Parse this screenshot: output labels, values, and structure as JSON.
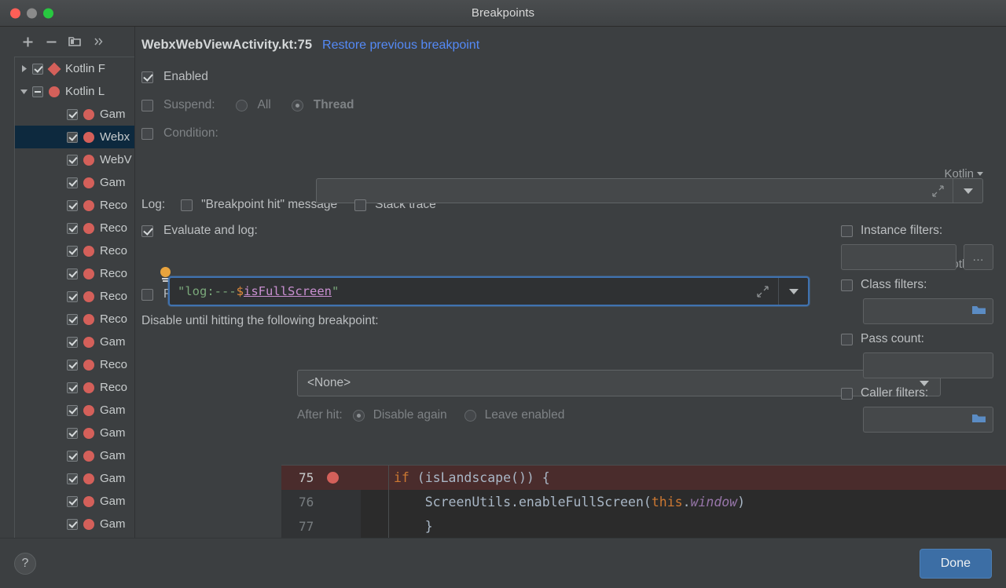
{
  "window": {
    "title": "Breakpoints",
    "traffic_lights": [
      "close",
      "minimize",
      "zoom"
    ]
  },
  "sidebar": {
    "toolbar": [
      {
        "name": "add-breakpoint-button",
        "icon": "plus-icon",
        "label": "+"
      },
      {
        "name": "remove-breakpoint-button",
        "icon": "minus-icon",
        "label": "−"
      },
      {
        "name": "group-breakpoints-button",
        "icon": "folder-icon",
        "label": ""
      },
      {
        "name": "more-options-button",
        "icon": "chevron-double-right-icon",
        "label": "»"
      }
    ],
    "items": [
      {
        "label": "Kotlin F",
        "indent": 0,
        "twisty": "collapsed",
        "checkbox": "checked",
        "marker": "diamond",
        "selected": false
      },
      {
        "label": "Kotlin L",
        "indent": 0,
        "twisty": "expanded",
        "checkbox": "mixed",
        "marker": "dot",
        "selected": false
      },
      {
        "label": "Gam",
        "indent": 1,
        "twisty": "",
        "checkbox": "checked",
        "marker": "dot",
        "selected": false
      },
      {
        "label": "Webx",
        "indent": 1,
        "twisty": "",
        "checkbox": "checked",
        "marker": "dot",
        "selected": true
      },
      {
        "label": "WebV",
        "indent": 1,
        "twisty": "",
        "checkbox": "checked",
        "marker": "dot",
        "selected": false
      },
      {
        "label": "Gam",
        "indent": 1,
        "twisty": "",
        "checkbox": "checked",
        "marker": "dot",
        "selected": false
      },
      {
        "label": "Reco",
        "indent": 1,
        "twisty": "",
        "checkbox": "checked",
        "marker": "dot",
        "selected": false
      },
      {
        "label": "Reco",
        "indent": 1,
        "twisty": "",
        "checkbox": "checked",
        "marker": "dot",
        "selected": false
      },
      {
        "label": "Reco",
        "indent": 1,
        "twisty": "",
        "checkbox": "checked",
        "marker": "dot",
        "selected": false
      },
      {
        "label": "Reco",
        "indent": 1,
        "twisty": "",
        "checkbox": "checked",
        "marker": "dot",
        "selected": false
      },
      {
        "label": "Reco",
        "indent": 1,
        "twisty": "",
        "checkbox": "checked",
        "marker": "dot",
        "selected": false
      },
      {
        "label": "Reco",
        "indent": 1,
        "twisty": "",
        "checkbox": "checked",
        "marker": "dot",
        "selected": false
      },
      {
        "label": "Gam",
        "indent": 1,
        "twisty": "",
        "checkbox": "checked",
        "marker": "dot",
        "selected": false
      },
      {
        "label": "Reco",
        "indent": 1,
        "twisty": "",
        "checkbox": "checked",
        "marker": "dot",
        "selected": false
      },
      {
        "label": "Reco",
        "indent": 1,
        "twisty": "",
        "checkbox": "checked",
        "marker": "dot",
        "selected": false
      },
      {
        "label": "Gam",
        "indent": 1,
        "twisty": "",
        "checkbox": "checked",
        "marker": "dot",
        "selected": false
      },
      {
        "label": "Gam",
        "indent": 1,
        "twisty": "",
        "checkbox": "checked",
        "marker": "dot",
        "selected": false
      },
      {
        "label": "Gam",
        "indent": 1,
        "twisty": "",
        "checkbox": "checked",
        "marker": "dot",
        "selected": false
      },
      {
        "label": "Gam",
        "indent": 1,
        "twisty": "",
        "checkbox": "checked",
        "marker": "dot",
        "selected": false
      },
      {
        "label": "Gam",
        "indent": 1,
        "twisty": "",
        "checkbox": "checked",
        "marker": "dot",
        "selected": false
      },
      {
        "label": "Gam",
        "indent": 1,
        "twisty": "",
        "checkbox": "checked",
        "marker": "dot",
        "selected": false
      }
    ]
  },
  "details": {
    "title": "WebxWebViewActivity.kt:75",
    "restore_link": "Restore previous breakpoint",
    "enabled": {
      "label": "Enabled",
      "checked": true
    },
    "suspend": {
      "label": "Suspend:",
      "checked": false,
      "options": [
        "All",
        "Thread"
      ],
      "selected": "Thread"
    },
    "condition": {
      "label": "Condition:",
      "checked": false,
      "value": "",
      "language": "Kotlin"
    },
    "log": {
      "label": "Log:",
      "breakpoint_hit_message": {
        "label": "\"Breakpoint hit\" message",
        "checked": false
      },
      "stack_trace": {
        "label": "Stack trace",
        "checked": false
      }
    },
    "evaluate_and_log": {
      "label": "Evaluate and log:",
      "checked": true,
      "language": "Kotlin",
      "code_tokens": [
        {
          "text": "\"log:---",
          "kind": "string"
        },
        {
          "text": "$",
          "kind": "dollar"
        },
        {
          "text": "isFullScreen",
          "kind": "variable"
        },
        {
          "text": "\"",
          "kind": "string"
        }
      ],
      "code_plain": "\"log:---$isFullScreen\""
    },
    "remove_once_hit": {
      "label": "Remove once hit",
      "checked": false
    },
    "disable_until": {
      "label": "Disable until hitting the following breakpoint:",
      "value": "<None>"
    },
    "after_hit": {
      "label": "After hit:",
      "options": [
        "Disable again",
        "Leave enabled"
      ],
      "selected": "Disable again",
      "disabled": true
    }
  },
  "filters": {
    "instance": {
      "label": "Instance filters:",
      "checked": false,
      "value": "",
      "button_label": "…"
    },
    "class": {
      "label": "Class filters:",
      "checked": false,
      "value": "",
      "icon": "folder-icon"
    },
    "pass_count": {
      "label": "Pass count:",
      "checked": false,
      "value": ""
    },
    "caller": {
      "label": "Caller filters:",
      "checked": false,
      "value": "",
      "icon": "folder-icon"
    }
  },
  "code_preview": {
    "lines": [
      {
        "number": "75",
        "current": true,
        "has_breakpoint": true,
        "tokens": [
          {
            "t": "if",
            "k": "kw"
          },
          {
            "t": " (isLandscape()) {",
            "k": "plain"
          }
        ]
      },
      {
        "number": "76",
        "current": false,
        "has_breakpoint": false,
        "tokens": [
          {
            "t": "    ScreenUtils.enableFullScreen(",
            "k": "plain"
          },
          {
            "t": "this",
            "k": "kw"
          },
          {
            "t": ".",
            "k": "plain"
          },
          {
            "t": "window",
            "k": "ital"
          },
          {
            "t": ")",
            "k": "plain"
          }
        ]
      },
      {
        "number": "77",
        "current": false,
        "has_breakpoint": false,
        "tokens": [
          {
            "t": "    }",
            "k": "plain"
          }
        ]
      }
    ]
  },
  "footer": {
    "help_label": "?",
    "done_label": "Done"
  },
  "colors": {
    "accent_link": "#548af7",
    "breakpoint_red": "#d4605a",
    "selection_blue": "#0d293e",
    "button_blue": "#3c6ea5",
    "focus_border": "#3f72b0",
    "panel_bg": "#3c3f41"
  }
}
